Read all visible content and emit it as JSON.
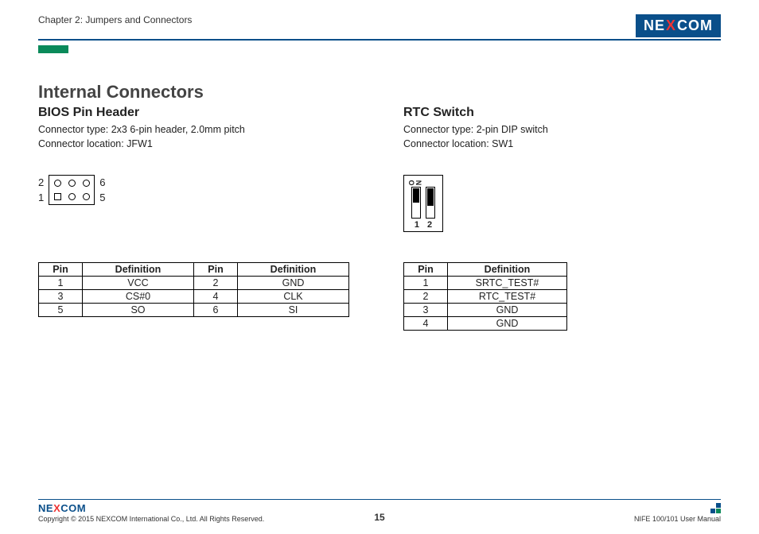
{
  "header": {
    "chapter": "Chapter 2: Jumpers and Connectors",
    "brand_pre": "NE",
    "brand_x": "X",
    "brand_post": "COM"
  },
  "section_title": "Internal Connectors",
  "left": {
    "title": "BIOS Pin Header",
    "spec1": "Connector type: 2x3 6-pin header, 2.0mm pitch",
    "spec2": "Connector location: JFW1",
    "lbl_tl": "2",
    "lbl_bl": "1",
    "lbl_tr": "6",
    "lbl_br": "5",
    "table": {
      "h1": "Pin",
      "h2": "Definition",
      "h3": "Pin",
      "h4": "Definition",
      "rows": [
        {
          "c1": "1",
          "c2": "VCC",
          "c3": "2",
          "c4": "GND"
        },
        {
          "c1": "3",
          "c2": "CS#0",
          "c3": "4",
          "c4": "CLK"
        },
        {
          "c1": "5",
          "c2": "SO",
          "c3": "6",
          "c4": "SI"
        }
      ]
    }
  },
  "right": {
    "title": "RTC Switch",
    "spec1": "Connector type: 2-pin DIP switch",
    "spec2": "Connector location: SW1",
    "on_o": "O",
    "on_n": "N",
    "num1": "1",
    "num2": "2",
    "table": {
      "h1": "Pin",
      "h2": "Definition",
      "rows": [
        {
          "c1": "1",
          "c2": "SRTC_TEST#"
        },
        {
          "c1": "2",
          "c2": "RTC_TEST#"
        },
        {
          "c1": "3",
          "c2": "GND"
        },
        {
          "c1": "4",
          "c2": "GND"
        }
      ]
    }
  },
  "footer": {
    "copyright": "Copyright © 2015 NEXCOM International Co., Ltd. All Rights Reserved.",
    "page": "15",
    "manual": "NIFE 100/101 User Manual"
  }
}
